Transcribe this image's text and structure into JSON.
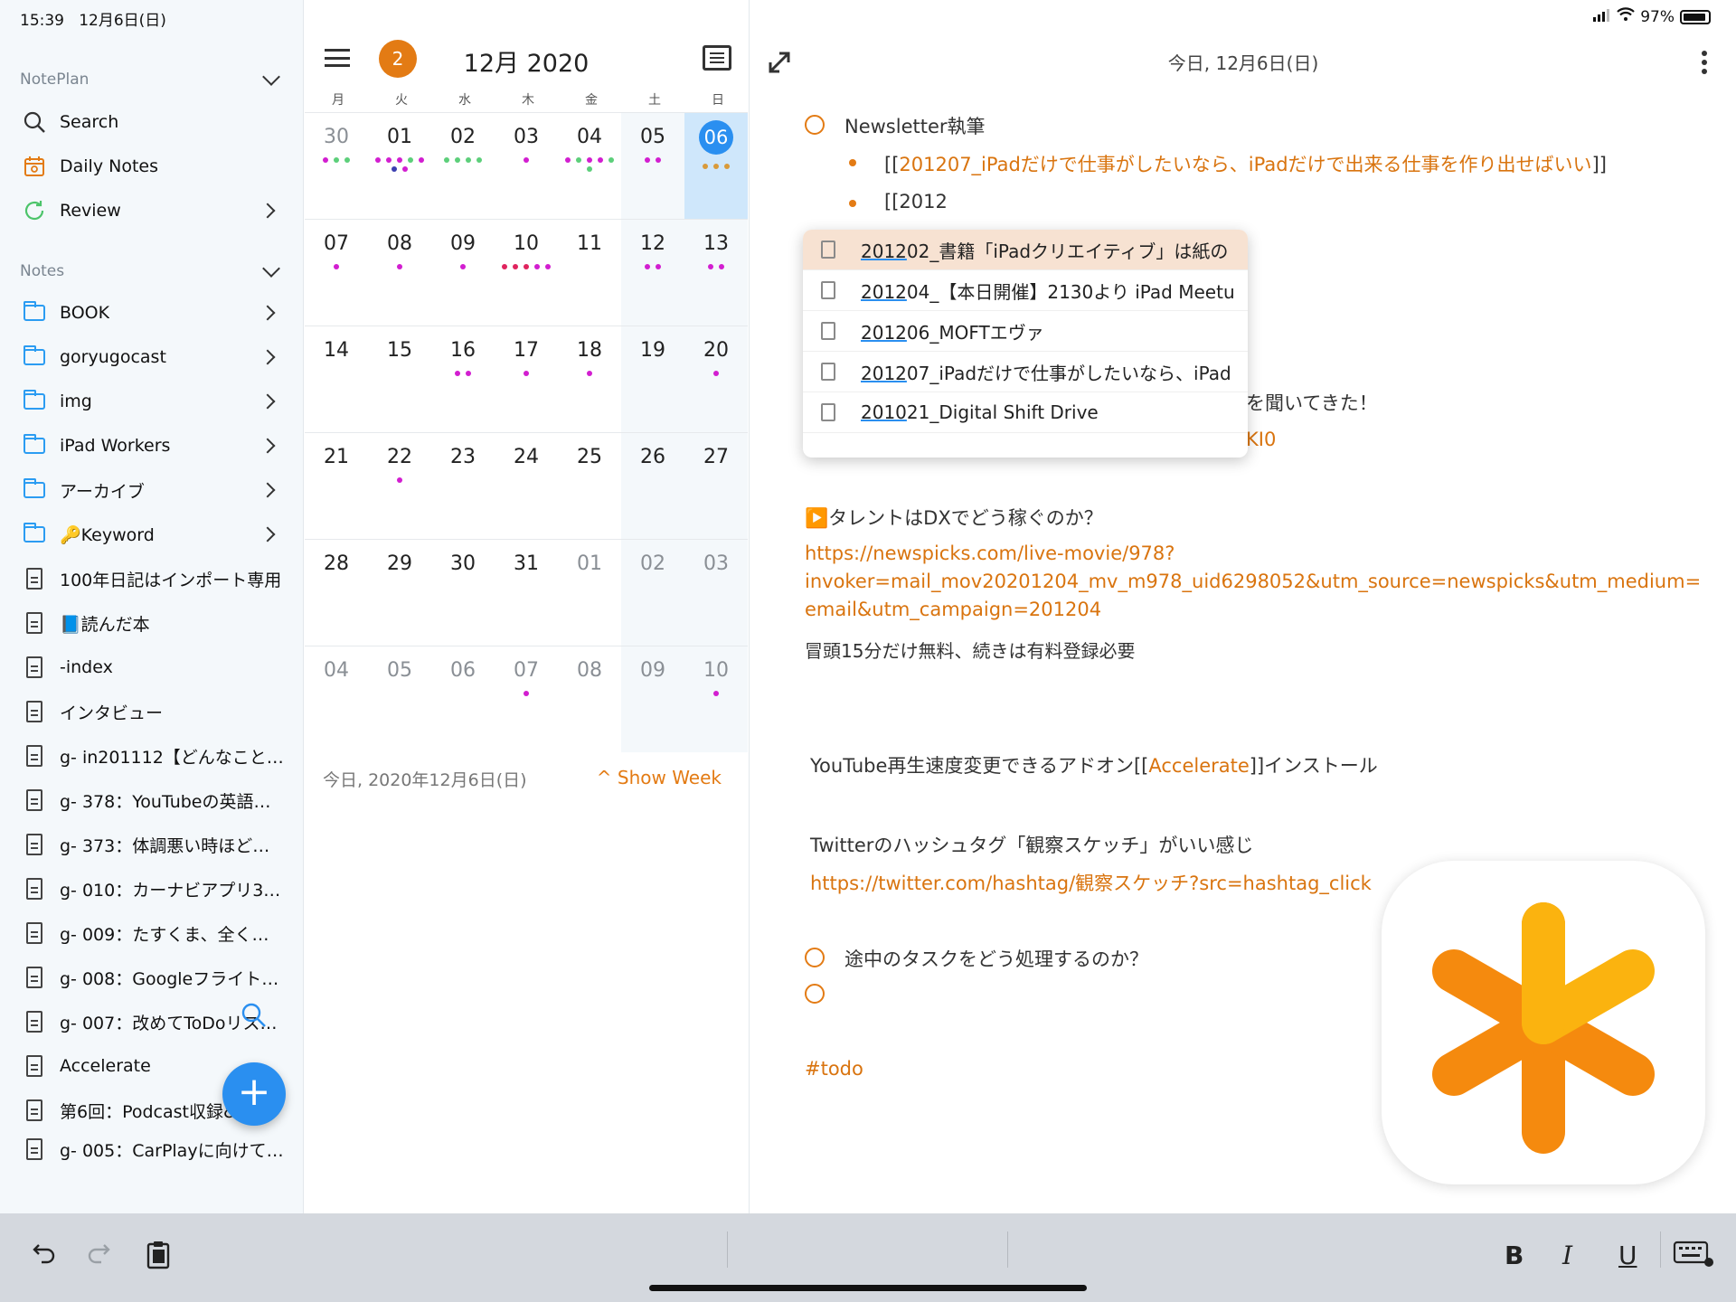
{
  "status": {
    "time": "15:39",
    "date": "12月6日(日)",
    "battery": "97%"
  },
  "sidebar": {
    "section_app": "NotePlan",
    "top_items": [
      {
        "label": "Search",
        "icon": "search-icon"
      },
      {
        "label": "Daily Notes",
        "icon": "calendar-icon"
      },
      {
        "label": "Review",
        "icon": "refresh-icon"
      }
    ],
    "section_notes": "Notes",
    "folders": [
      "BOOK",
      "goryugocast",
      "img",
      "iPad Workers",
      "アーカイブ",
      "🔑Keyword"
    ],
    "notes": [
      "100年日記はインポート専用",
      "📘読んだ本",
      "-index",
      "インタビュー",
      "g- in201112【どんなこと…",
      "g- 378：YouTubeの英語…",
      "g- 373：体調悪い時ほど日…",
      "g- 010：カーナビアプリ3…",
      "g- 009：たすくま、全く使…",
      "g- 008：Googleフライト…",
      "g- 007：改めてToDoリス…",
      "Accelerate",
      "第6回：Podcast収録&…",
      "g- 005：CarPlayに向けて…"
    ],
    "fab_label": "+"
  },
  "calendar": {
    "badge": "2",
    "title": "12月 2020",
    "weekdays": [
      "月",
      "火",
      "水",
      "木",
      "金",
      "土",
      "日"
    ],
    "weeks": [
      [
        "30",
        "01",
        "02",
        "03",
        "04",
        "05",
        "06"
      ],
      [
        "07",
        "08",
        "09",
        "10",
        "11",
        "12",
        "13"
      ],
      [
        "14",
        "15",
        "16",
        "17",
        "18",
        "19",
        "20"
      ],
      [
        "21",
        "22",
        "23",
        "24",
        "25",
        "26",
        "27"
      ],
      [
        "28",
        "29",
        "30",
        "31",
        "01",
        "02",
        "03"
      ],
      [
        "04",
        "05",
        "06",
        "07",
        "08",
        "09",
        "10"
      ]
    ],
    "footer_date": "今日, 2020年12月6日(日)",
    "show_week": "^ Show Week",
    "colors": {
      "magenta": "#d21ed0",
      "green": "#5ccf7a",
      "navy": "#3b3fb0",
      "orange": "#d99a3a",
      "red": "#e0245e"
    }
  },
  "editor": {
    "title": "今日, 12月6日(日)",
    "task1": "Newsletter執筆",
    "bullet1_prefix": "[[",
    "bullet1_link": "201207_iPadだけで仕事がしたいなら、iPadだけで出来る仕事を作り出せばいい",
    "bullet1_suffix": "]]",
    "bullet2": "[[2012",
    "hidden_line_a": "を聞いてきた！",
    "hidden_line_b": "KI0",
    "video_line": "▶️タレントはDXでどう稼ぐのか？",
    "url1_line1": "https://newspicks.com/live-movie/978?",
    "url1_line2": "invoker=mail_mov20201204_mv_m978_uid6298052&utm_source=newspicks&utm_medium=",
    "url1_line3": "email&utm_campaign=201204",
    "note1": "冒頭15分だけ無料、続きは有料登録必要",
    "yt_prefix": "YouTube再生速度変更できるアドオン[[",
    "yt_link": "Accelerate",
    "yt_suffix": "]]インストール",
    "tw_line": "Twitterのハッシュタグ「観察スケッチ」がいい感じ",
    "tw_url": "https://twitter.com/hashtag/観察スケッチ?src=hashtag_click",
    "task2": "途中のタスクをどう処理するのか？",
    "tag": "#todo"
  },
  "autocomplete": {
    "items": [
      {
        "match": "2012",
        "rest": "02_書籍「iPadクリエイティブ」は紙の"
      },
      {
        "match": "2012",
        "rest": "04_【本日開催】2130より iPad Meetu"
      },
      {
        "match": "2012",
        "rest": "06_MOFTエヴァ"
      },
      {
        "match": "2012",
        "rest": "07_iPadだけで仕事がしたいなら、iPad"
      },
      {
        "match": "2010",
        "rest": "21_Digital Shift Drive"
      }
    ]
  },
  "toolbar": {
    "bold": "B",
    "italic": "I",
    "underline": "U"
  }
}
